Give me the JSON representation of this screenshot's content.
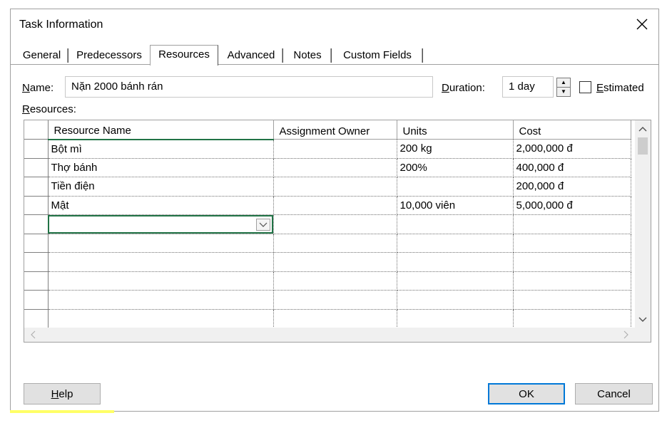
{
  "dialog": {
    "title": "Task Information",
    "close_glyph": "close-icon"
  },
  "tabs": [
    {
      "label": "General"
    },
    {
      "label": "Predecessors"
    },
    {
      "label": "Resources",
      "active": true
    },
    {
      "label": "Advanced"
    },
    {
      "label": "Notes"
    },
    {
      "label": "Custom Fields"
    }
  ],
  "name_field": {
    "label_underlined": "N",
    "label_rest": "ame:",
    "value": "Nặn 2000 bánh rán"
  },
  "duration_field": {
    "label_underlined": "D",
    "label_rest": "uration:",
    "value": "1 day"
  },
  "estimated": {
    "label_underlined": "E",
    "label_rest": "stimated",
    "checked": false
  },
  "resources_label": {
    "underlined": "R",
    "rest": "esources:"
  },
  "grid": {
    "columns": [
      "Resource Name",
      "Assignment Owner",
      "Units",
      "Cost"
    ],
    "rows": [
      {
        "resource": "Bột mì",
        "owner": "",
        "units": "200 kg",
        "cost": "2,000,000 đ"
      },
      {
        "resource": "Thợ bánh",
        "owner": "",
        "units": "200%",
        "cost": "400,000 đ"
      },
      {
        "resource": "Tiền điện",
        "owner": "",
        "units": "",
        "cost": "200,000 đ"
      },
      {
        "resource": "Mật",
        "owner": "",
        "units": "10,000 viên",
        "cost": "5,000,000 đ"
      },
      {
        "resource": "",
        "owner": "",
        "units": "",
        "cost": ""
      },
      {
        "resource": "",
        "owner": "",
        "units": "",
        "cost": ""
      },
      {
        "resource": "",
        "owner": "",
        "units": "",
        "cost": ""
      },
      {
        "resource": "",
        "owner": "",
        "units": "",
        "cost": ""
      },
      {
        "resource": "",
        "owner": "",
        "units": "",
        "cost": ""
      },
      {
        "resource": "",
        "owner": "",
        "units": "",
        "cost": ""
      }
    ]
  },
  "buttons": {
    "help_underlined": "H",
    "help_rest": "elp",
    "ok": "OK",
    "cancel": "Cancel"
  },
  "colors": {
    "selection": "#217346",
    "default_button_border": "#0078d7"
  }
}
